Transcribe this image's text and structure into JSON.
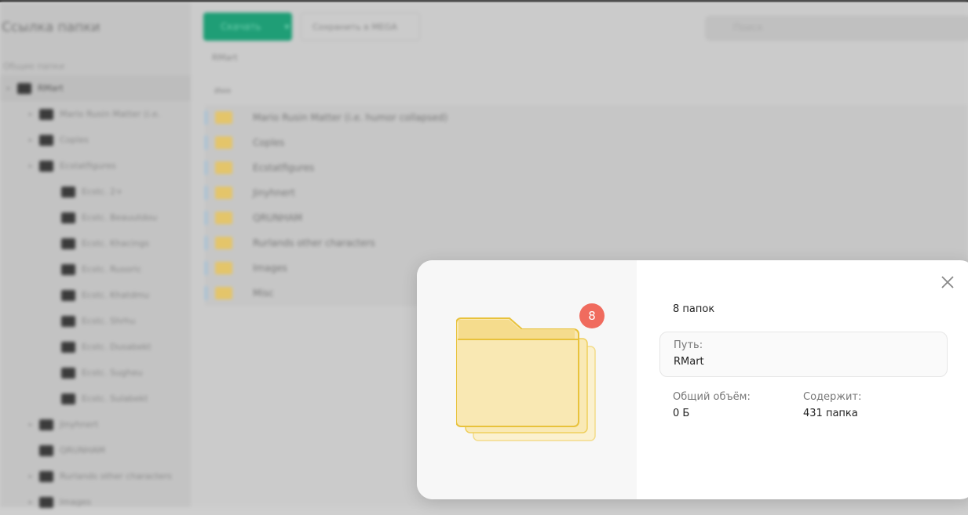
{
  "sidebar": {
    "title": "Ссылка папки",
    "subtitle": "Общие папки",
    "items": [
      {
        "label": "RMart",
        "level": 0
      },
      {
        "label": "Mario Rusin Matter (i.e.",
        "level": 1
      },
      {
        "label": "Coples",
        "level": 1
      },
      {
        "label": "Ecstatfigures",
        "level": 1
      },
      {
        "label": "Ecstc. 2+",
        "level": 2
      },
      {
        "label": "Ecstc. Beauutdou",
        "level": 2
      },
      {
        "label": "Ecstc. Khacings",
        "level": 2
      },
      {
        "label": "Ecstc. Rusoric",
        "level": 2
      },
      {
        "label": "Ecstc. Khatdmu",
        "level": 2
      },
      {
        "label": "Ecstc. Shrhu",
        "level": 2
      },
      {
        "label": "Ecstc. Dusabekt",
        "level": 2
      },
      {
        "label": "Ecstc. Sugheu",
        "level": 2
      },
      {
        "label": "Ecstc. Sulabekt",
        "level": 2
      },
      {
        "label": "Jinyhnert",
        "level": 1
      },
      {
        "label": "QRUNHAM",
        "level": 1
      },
      {
        "label": "Rurlands other characters",
        "level": 1
      },
      {
        "label": "Images",
        "level": 1
      }
    ]
  },
  "toolbar": {
    "download": "Скачать",
    "save": "Сохранить в MEGA",
    "search_placeholder": "Поиск"
  },
  "breadcrumb": "RMart",
  "table": {
    "column": "Имя",
    "rows": [
      "Mario Rusin Matter (i.e. humor collapsed)",
      "Coples",
      "Ecstatfigures",
      "Jinyhnert",
      "QRUNHAM",
      "Rurlands other characters",
      "Images",
      "Misc"
    ]
  },
  "modal": {
    "badge": "8",
    "count": "8 папок",
    "path_label": "Путь:",
    "path_value": "RMart",
    "size_label": "Общий объём:",
    "size_value": "0 Б",
    "contains_label": "Содержит:",
    "contains_value": "431 папка"
  },
  "colors": {
    "accent": "#1f9e76",
    "badge": "#f06b5e",
    "folder": "#f9e8b3"
  }
}
